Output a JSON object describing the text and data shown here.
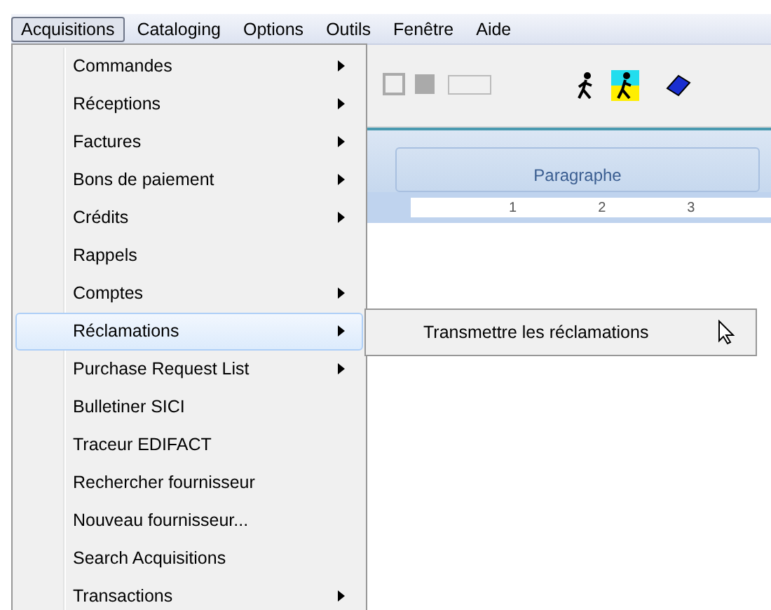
{
  "menu_bar": [
    {
      "label": "Acquisitions",
      "selected": true
    },
    {
      "label": "Cataloging",
      "selected": false
    },
    {
      "label": "Options",
      "selected": false
    },
    {
      "label": "Outils",
      "selected": false
    },
    {
      "label": "Fenêtre",
      "selected": false
    },
    {
      "label": "Aide",
      "selected": false
    }
  ],
  "ribbon": {
    "group_label": "Paragraphe"
  },
  "ruler": {
    "ticks": [
      "1",
      "2",
      "3"
    ]
  },
  "dropdown": {
    "items": [
      {
        "label": "Commandes",
        "has_submenu": true,
        "selected": false
      },
      {
        "label": "Réceptions",
        "has_submenu": true,
        "selected": false
      },
      {
        "label": "Factures",
        "has_submenu": true,
        "selected": false
      },
      {
        "label": "Bons de paiement",
        "has_submenu": true,
        "selected": false
      },
      {
        "label": "Crédits",
        "has_submenu": true,
        "selected": false
      },
      {
        "label": "Rappels",
        "has_submenu": false,
        "selected": false
      },
      {
        "label": "Comptes",
        "has_submenu": true,
        "selected": false
      },
      {
        "label": "Réclamations",
        "has_submenu": true,
        "selected": true
      },
      {
        "label": "Purchase Request List",
        "has_submenu": true,
        "selected": false
      },
      {
        "label": "Bulletiner SICI",
        "has_submenu": false,
        "selected": false
      },
      {
        "label": "Traceur EDIFACT",
        "has_submenu": false,
        "selected": false
      },
      {
        "label": "Rechercher fournisseur",
        "has_submenu": false,
        "selected": false
      },
      {
        "label": "Nouveau fournisseur...",
        "has_submenu": false,
        "selected": false
      },
      {
        "label": "Search Acquisitions",
        "has_submenu": false,
        "selected": false
      },
      {
        "label": "Transactions",
        "has_submenu": true,
        "selected": false
      }
    ]
  },
  "submenu": {
    "items": [
      {
        "label": "Transmettre les réclamations",
        "selected": false
      }
    ]
  }
}
